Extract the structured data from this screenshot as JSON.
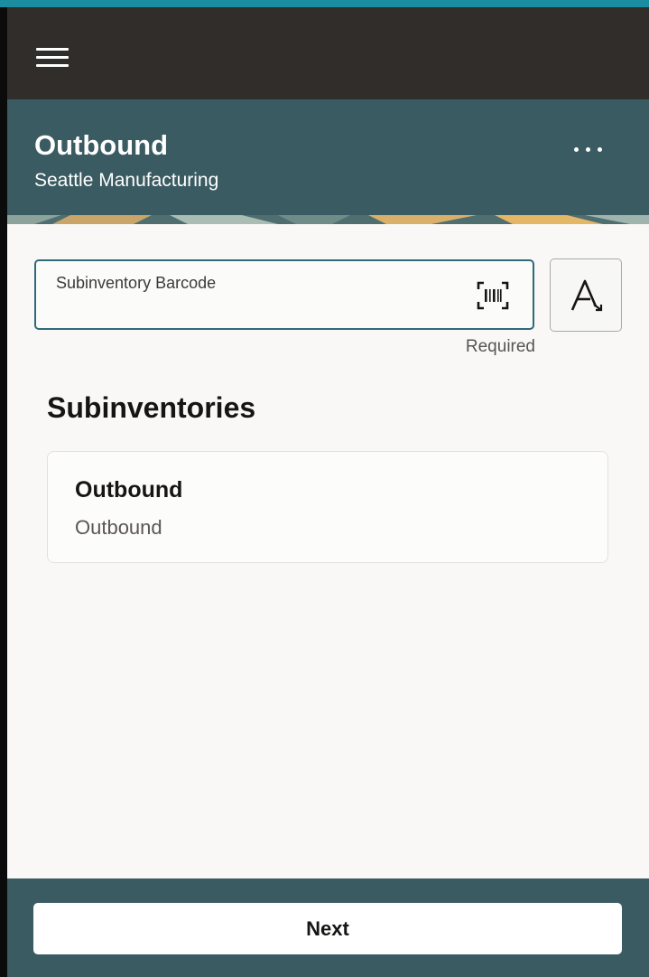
{
  "header": {
    "title": "Outbound",
    "subtitle": "Seattle Manufacturing"
  },
  "icons": {
    "menu": "hamburger-menu-icon",
    "more": "more-options-icon",
    "barcode": "barcode-scan-icon",
    "font_size": "text-size-icon"
  },
  "form": {
    "barcode_label": "Subinventory Barcode",
    "barcode_value": "",
    "required_text": "Required"
  },
  "section": {
    "title": "Subinventories"
  },
  "subinventories": [
    {
      "title": "Outbound",
      "subtitle": "Outbound"
    }
  ],
  "footer": {
    "next_label": "Next"
  },
  "colors": {
    "topbar": "#312d2a",
    "header": "#3a5b61",
    "accent_border": "#2f6a7a",
    "page_background": "#f9f8f6"
  }
}
